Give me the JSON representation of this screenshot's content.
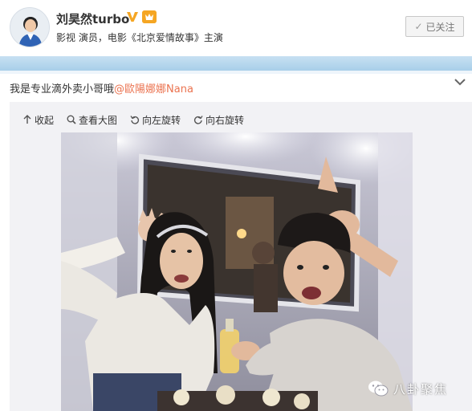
{
  "profile": {
    "name": "刘昊然turbo",
    "bio": "影视 演员，电影《北京爱情故事》主演",
    "follow_label": "已关注",
    "verified_icon": "verified-v-icon",
    "level_icon": "vip-level-icon"
  },
  "post": {
    "text": "我是专业滴外卖小哥哦",
    "mention": "@歐陽娜娜Nana"
  },
  "toolbar": {
    "collapse_label": "收起",
    "view_large_label": "查看大图",
    "rotate_left_label": "向左旋转",
    "rotate_right_label": "向右旋转"
  },
  "watermark": {
    "text": "八卦聚焦",
    "icon": "wechat-icon"
  },
  "colors": {
    "mention": "#eb7350",
    "verified_badge": "#f5a623",
    "band": "#b3d5ec"
  }
}
